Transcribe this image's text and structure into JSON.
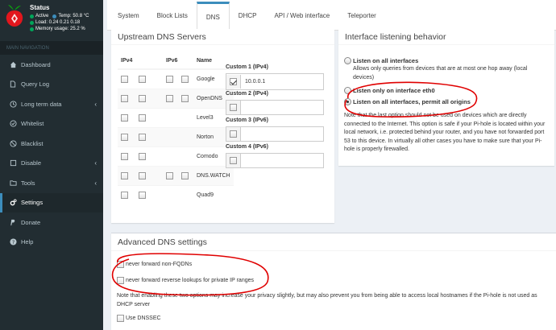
{
  "sidebar": {
    "status_title": "Status",
    "status_active": "Active",
    "status_temp": "Temp: 50.8 °C",
    "status_load": "Load:  0.24  0.21  0.18",
    "status_memory": "Memory usage:  25.2 %",
    "nav_header": "MAIN NAVIGATION",
    "items": [
      {
        "label": "Dashboard",
        "icon": "home-icon"
      },
      {
        "label": "Query Log",
        "icon": "file-icon"
      },
      {
        "label": "Long term data",
        "icon": "clock-icon"
      },
      {
        "label": "Whitelist",
        "icon": "check-circle-icon"
      },
      {
        "label": "Blacklist",
        "icon": "ban-icon"
      },
      {
        "label": "Disable",
        "icon": "stop-icon"
      },
      {
        "label": "Tools",
        "icon": "folder-icon"
      },
      {
        "label": "Settings",
        "icon": "gears-icon"
      },
      {
        "label": "Donate",
        "icon": "paypal-icon"
      },
      {
        "label": "Help",
        "icon": "question-icon"
      }
    ]
  },
  "tabs": [
    "System",
    "Block Lists",
    "DNS",
    "DHCP",
    "API / Web interface",
    "Teleporter"
  ],
  "upstream": {
    "title": "Upstream DNS Servers",
    "headers": [
      "IPv4",
      "IPv6",
      "Name"
    ],
    "servers": [
      "Google",
      "OpenDNS",
      "Level3",
      "Norton",
      "Comodo",
      "DNS.WATCH",
      "Quad9"
    ],
    "custom": [
      {
        "label": "Custom 1 (IPv4)",
        "value": "10.0.0.1",
        "checked": true
      },
      {
        "label": "Custom 2 (IPv4)",
        "value": "",
        "checked": false
      },
      {
        "label": "Custom 3 (IPv6)",
        "value": "",
        "checked": false
      },
      {
        "label": "Custom 4 (IPv6)",
        "value": "",
        "checked": false
      }
    ]
  },
  "interface": {
    "title": "Interface listening behavior",
    "opt1_label": "Listen on all interfaces",
    "opt1_desc": "Allows only queries from devices that are at most one hop away (local devices)",
    "opt2_label": "Listen only on interface eth0",
    "opt3_label": "Listen on all interfaces, permit all origins",
    "note": "Note that the last option should not be used on devices which are directly connected to the Internet. This option is safe if your Pi-hole is located within your local network, i.e. protected behind your router, and you have not forwarded port 53 to this device. In virtually all other cases you have to make sure that your Pi-hole is properly firewalled."
  },
  "advanced": {
    "title": "Advanced DNS settings",
    "opt_fqdn": "never forward non-FQDNs",
    "opt_reverse": "never forward reverse lookups for private IP ranges",
    "note": "Note that enabling these two options may increase your privacy slightly, but may also prevent you from being able to access local hostnames if the Pi-hole is not used as DHCP server",
    "opt_dnssec": "Use DNSSEC"
  },
  "colors": {
    "sidebar_bg": "#222d32",
    "accent": "#3c8dbc",
    "annotation": "#e00000",
    "active_dot": "#00a65a"
  }
}
